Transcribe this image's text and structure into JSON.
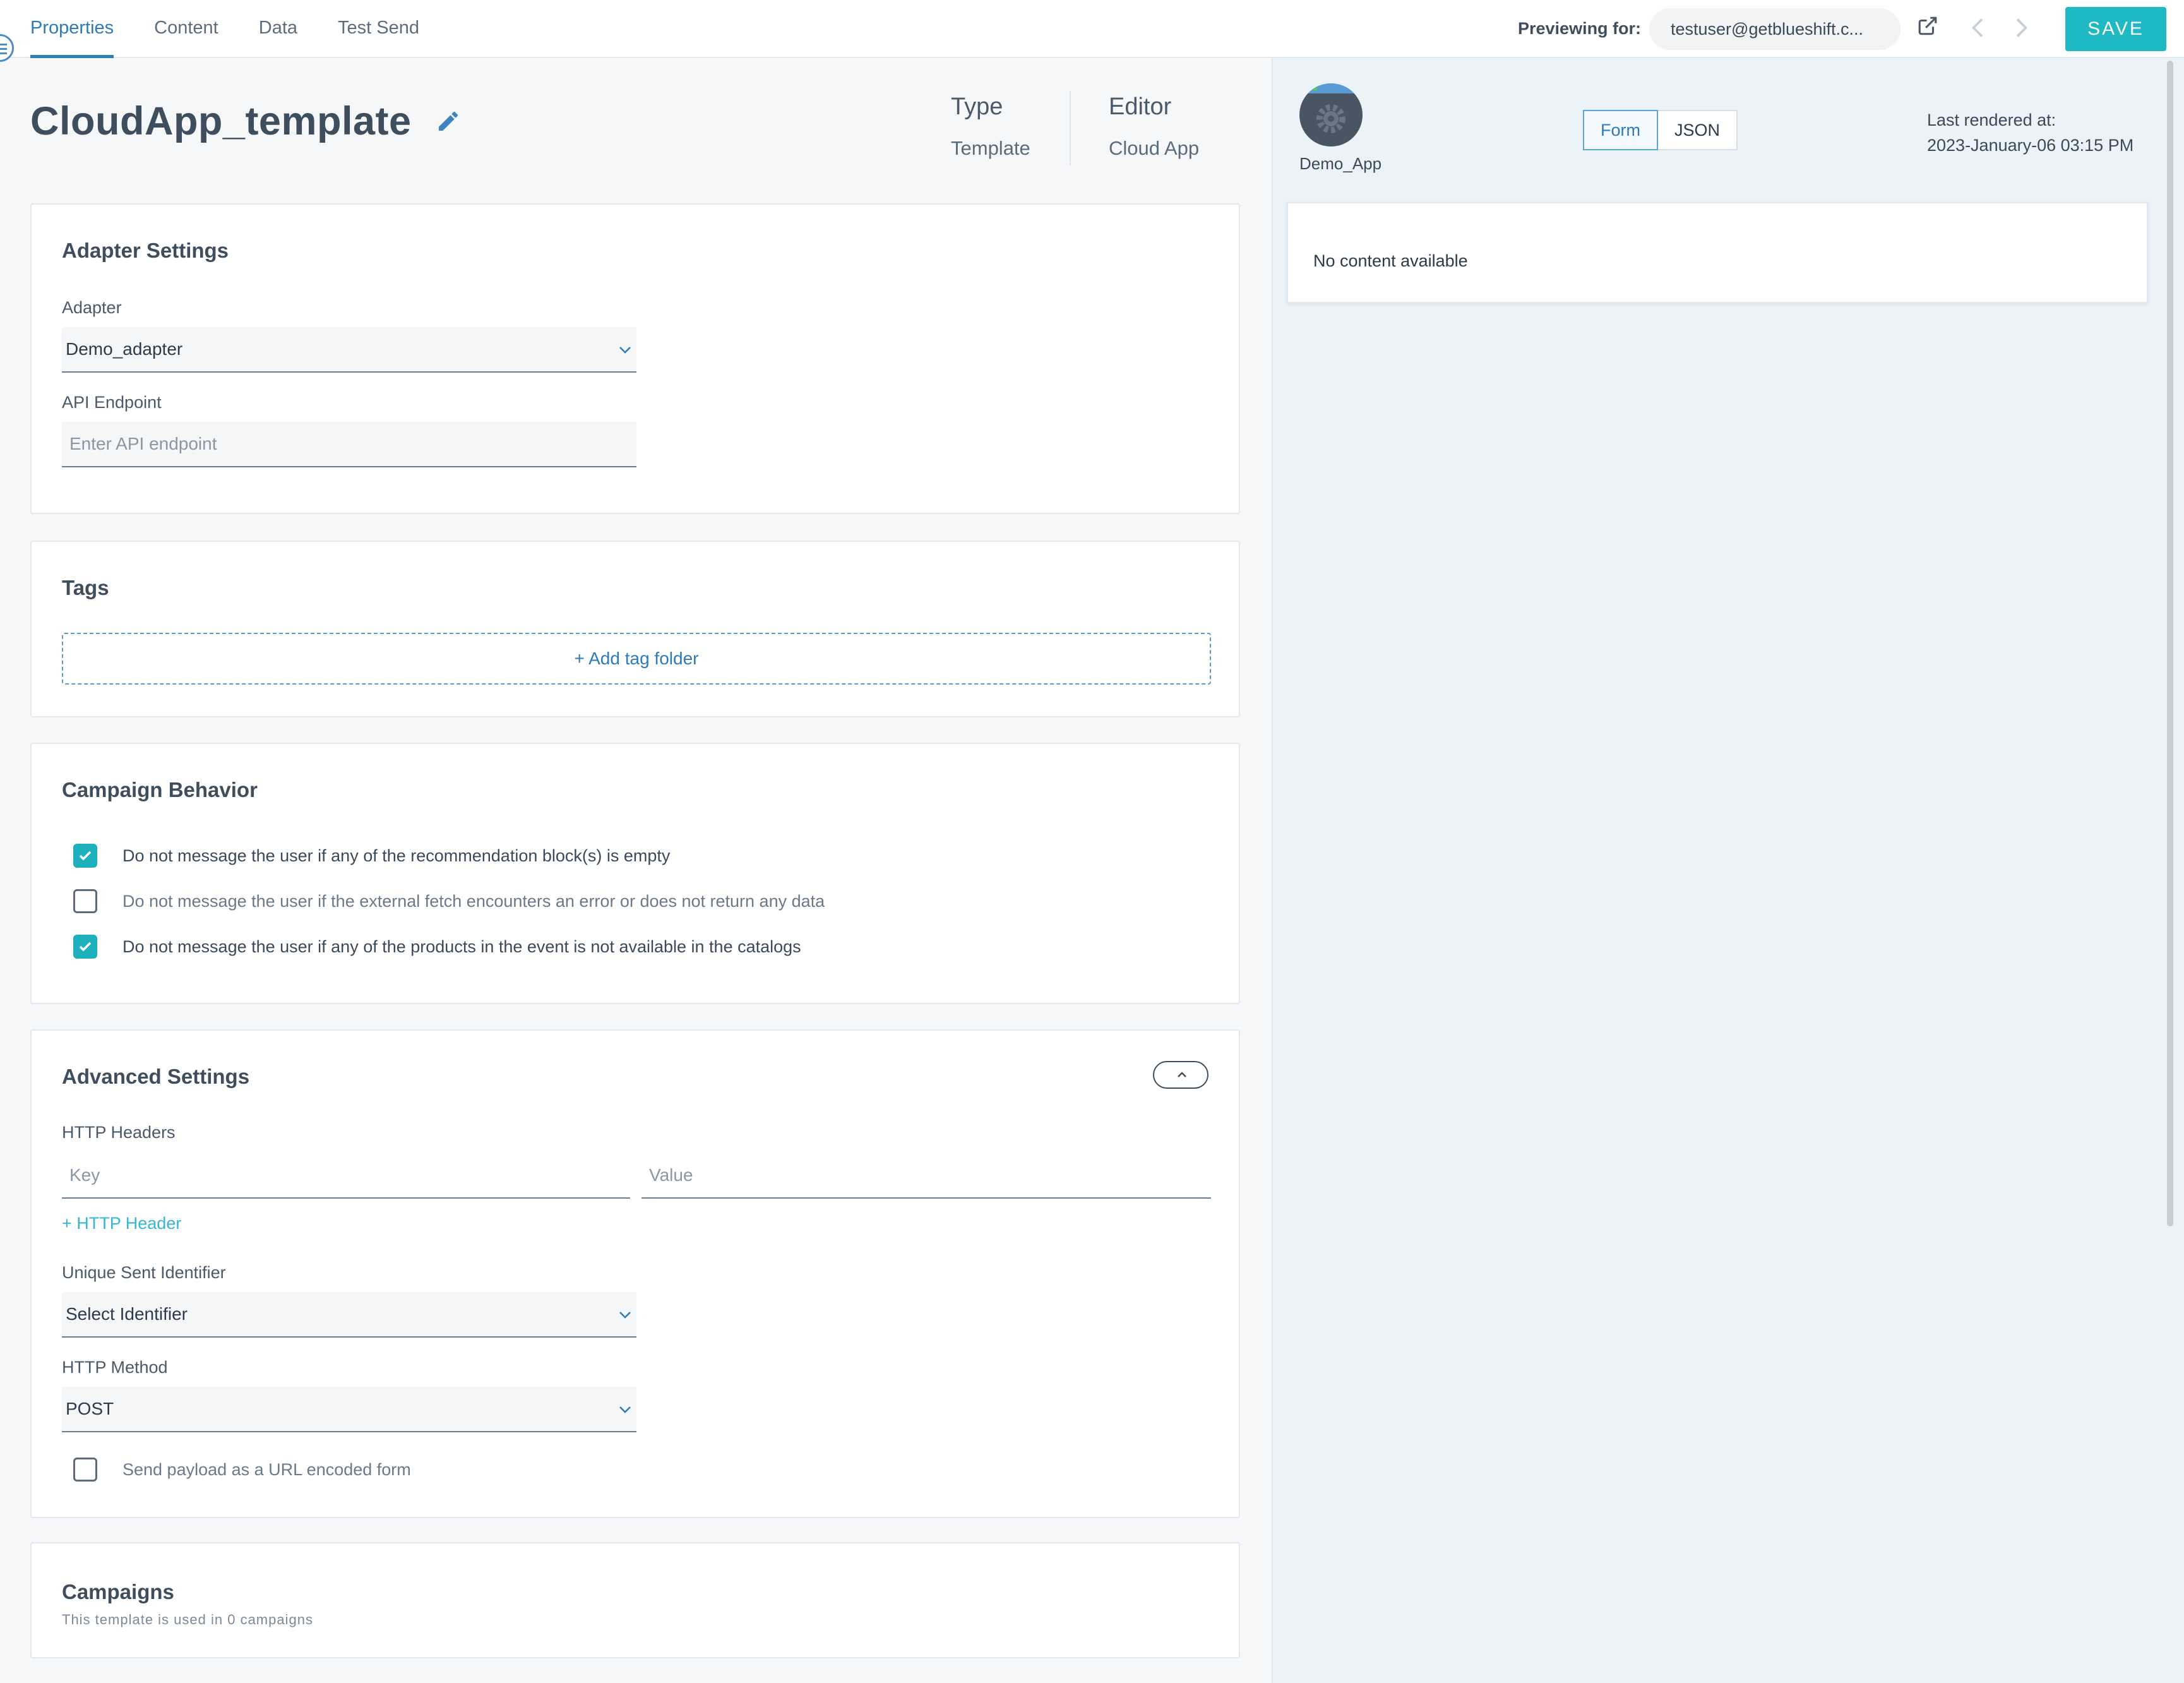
{
  "tabs": [
    {
      "label": "Properties",
      "active": true
    },
    {
      "label": "Content",
      "active": false
    },
    {
      "label": "Data",
      "active": false
    },
    {
      "label": "Test Send",
      "active": false
    }
  ],
  "preview": {
    "label": "Previewing for:",
    "user": "testuser@getblueshift.c..."
  },
  "save_label": "SAVE",
  "header": {
    "title": "CloudApp_template",
    "type_label": "Type",
    "type_value": "Template",
    "editor_label": "Editor",
    "editor_value": "Cloud App"
  },
  "adapter_settings": {
    "title": "Adapter Settings",
    "adapter_label": "Adapter",
    "adapter_value": "Demo_adapter",
    "endpoint_label": "API Endpoint",
    "endpoint_placeholder": "Enter API endpoint"
  },
  "tags": {
    "title": "Tags",
    "add_label": "+ Add tag folder"
  },
  "campaign_behavior": {
    "title": "Campaign Behavior",
    "options": [
      {
        "label": "Do not message the user if any of the recommendation block(s) is empty",
        "checked": true
      },
      {
        "label": "Do not message the user if the external fetch encounters an error or does not return any data",
        "checked": false
      },
      {
        "label": "Do not message the user if any of the products in the event is not available in the catalogs",
        "checked": true
      }
    ]
  },
  "advanced_settings": {
    "title": "Advanced Settings",
    "headers_label": "HTTP Headers",
    "key_placeholder": "Key",
    "value_placeholder": "Value",
    "add_header_label": "+ HTTP Header",
    "identifier_label": "Unique Sent Identifier",
    "identifier_value": "Select Identifier",
    "method_label": "HTTP Method",
    "method_value": "POST",
    "url_encoded_label": "Send payload as a URL encoded form",
    "url_encoded_checked": false
  },
  "campaigns": {
    "title": "Campaigns",
    "subtitle": "This template is used in 0 campaigns"
  },
  "preview_panel": {
    "app_name": "Demo_App",
    "view_modes": [
      "Form",
      "JSON"
    ],
    "active_view": "Form",
    "last_rendered_label": "Last rendered at:",
    "last_rendered_value": "2023-January-06 03:15 PM",
    "empty_message": "No content available"
  },
  "colors": {
    "accent": "#1fb9c4",
    "link": "#2d7bb7",
    "checkbox": "#1fb0bd"
  }
}
